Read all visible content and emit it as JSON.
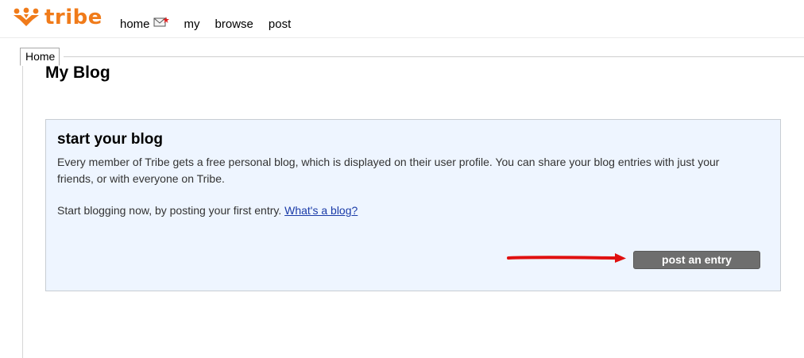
{
  "header": {
    "logo_text": "tribe",
    "logo_icon": "tribe-figures-icon",
    "brand_color": "#f07b1a",
    "nav": [
      {
        "label": "home",
        "icon": "mail-notification-icon"
      },
      {
        "label": "my"
      },
      {
        "label": "browse"
      },
      {
        "label": "post"
      }
    ]
  },
  "tabs": {
    "home_label": "Home"
  },
  "main": {
    "page_title": "My Blog",
    "blog_box": {
      "title": "start your blog",
      "description": "Every member of Tribe gets a free personal blog, which is displayed on their user profile. You can share your blog entries with just your friends, or with everyone on Tribe.",
      "cta_text": "Start blogging now, by posting your first entry.",
      "help_link": "What's a blog?",
      "button_label": "post an entry",
      "box_background": "#eef5ff",
      "button_color": "#6e6e6e",
      "annotation_arrow_color": "#e01010"
    }
  }
}
